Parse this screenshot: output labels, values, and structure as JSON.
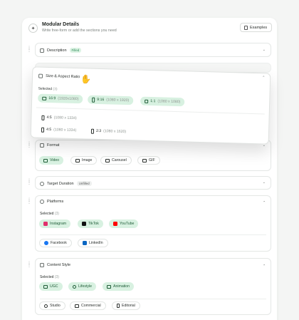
{
  "header": {
    "title": "Modular Details",
    "subtitle": "Write free-form or add the sections you need",
    "examples_label": "Examples"
  },
  "description": {
    "label": "Description",
    "badge": "Filled"
  },
  "size": {
    "label": "Size & Aspect Ratio",
    "selected_label": "Selected",
    "selected_count": "(3)",
    "options": [
      {
        "label": "16:9",
        "dim": "(1920x1080)",
        "selected": true,
        "icon": "landscape-icon"
      },
      {
        "label": "9:16",
        "dim": "(1080 x 1920)",
        "selected": true,
        "icon": "portrait-icon"
      },
      {
        "label": "1:1",
        "dim": "(1080 x 1080)",
        "selected": true,
        "icon": "square-icon"
      },
      {
        "label": "4:5",
        "dim": "(1080 x 1334)",
        "selected": false,
        "icon": "portrait-icon"
      },
      {
        "label": "4:5",
        "dim": "(1080 x 1334)",
        "selected": false,
        "icon": "portrait-icon"
      },
      {
        "label": "2:3",
        "dim": "(1080 x 1620)",
        "selected": false,
        "icon": "portrait-icon"
      }
    ]
  },
  "format": {
    "label": "Format",
    "options": [
      {
        "label": "Video",
        "selected": true
      },
      {
        "label": "Image",
        "selected": false
      },
      {
        "label": "Carousel",
        "selected": false
      },
      {
        "label": "GIF",
        "selected": false
      }
    ]
  },
  "target_duration": {
    "label": "Target Duration",
    "badge": "Unfilled"
  },
  "platforms": {
    "label": "Platforms",
    "selected_label": "Selected",
    "selected_count": "(3)",
    "options": [
      {
        "label": "Instagram",
        "selected": true,
        "color": "#e1306c"
      },
      {
        "label": "TikTok",
        "selected": true,
        "color": "#111111"
      },
      {
        "label": "YouTube",
        "selected": true,
        "color": "#ff0000"
      },
      {
        "label": "Facebook",
        "selected": false,
        "color": "#1877f2"
      },
      {
        "label": "LinkedIn",
        "selected": false,
        "color": "#0a66c2"
      }
    ]
  },
  "content_style": {
    "label": "Content Style",
    "selected_label": "Selected",
    "selected_count": "(3)",
    "options": [
      {
        "label": "UGC",
        "selected": true
      },
      {
        "label": "Lifestyle",
        "selected": true
      },
      {
        "label": "Animation",
        "selected": true
      },
      {
        "label": "Studio",
        "selected": false
      },
      {
        "label": "Commercial",
        "selected": false
      },
      {
        "label": "Editorial",
        "selected": false
      }
    ]
  },
  "colors": {
    "accent_bg": "#d8f1e1",
    "accent_text": "#1f5c37",
    "badge_green": "#2e8b57"
  }
}
